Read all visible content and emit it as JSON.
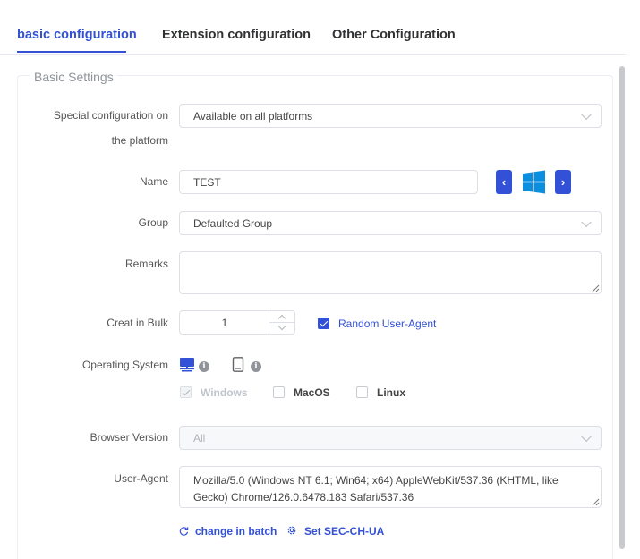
{
  "tabs": [
    {
      "label": "basic configuration"
    },
    {
      "label": "Extension configuration"
    },
    {
      "label": "Other Configuration"
    }
  ],
  "section_title": "Basic Settings",
  "platform": {
    "label_line1": "Special configuration on",
    "label_line2": "the platform",
    "value": "Available on all platforms"
  },
  "name": {
    "label": "Name",
    "value": "TEST",
    "prev_label": "‹",
    "next_label": "›"
  },
  "group": {
    "label": "Group",
    "value": "Defaulted Group"
  },
  "remarks": {
    "label": "Remarks",
    "value": ""
  },
  "bulk": {
    "label": "Creat in Bulk",
    "value": "1",
    "random_ua_label": "Random User-Agent",
    "random_ua_checked": true
  },
  "os": {
    "label": "Operating System",
    "info_glyph": "i",
    "options": [
      {
        "label": "Windows",
        "checked": true,
        "disabled": true
      },
      {
        "label": "MacOS",
        "checked": false
      },
      {
        "label": "Linux",
        "checked": false
      }
    ]
  },
  "browser_version": {
    "label": "Browser Version",
    "value": "All"
  },
  "user_agent": {
    "label": "User-Agent",
    "value": "Mozilla/5.0 (Windows NT 6.1; Win64; x64) AppleWebKit/537.36 (KHTML, like Gecko) Chrome/126.0.6478.183 Safari/537.36"
  },
  "actions": {
    "change_batch": "change in batch",
    "set_sec_ch_ua": "Set SEC-CH-UA"
  },
  "colors": {
    "accent": "#3351d6",
    "windows_blue": "#0a8fe0"
  }
}
